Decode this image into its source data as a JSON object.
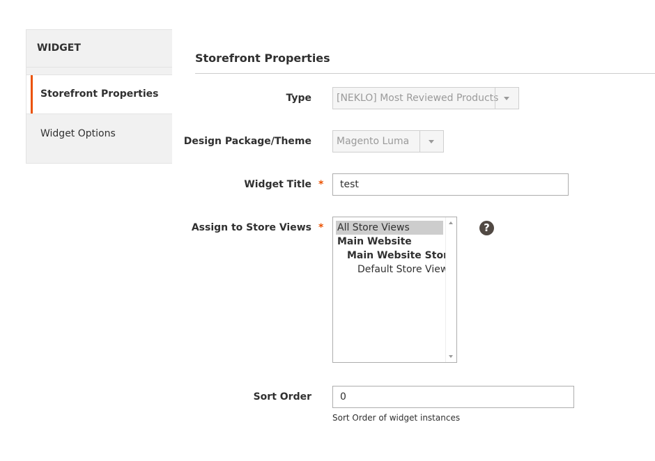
{
  "sidebar": {
    "title": "WIDGET",
    "items": [
      {
        "label": "Storefront Properties",
        "active": true
      },
      {
        "label": "Widget Options",
        "active": false
      }
    ]
  },
  "main": {
    "section_title": "Storefront Properties",
    "fields": {
      "type": {
        "label": "Type",
        "value": "[NEKLO] Most Reviewed Products"
      },
      "theme": {
        "label": "Design Package/Theme",
        "value": "Magento Luma"
      },
      "widget_title": {
        "label": "Widget Title",
        "required_mark": "*",
        "value": "test"
      },
      "store_views": {
        "label": "Assign to Store Views",
        "required_mark": "*",
        "options": [
          "All Store Views",
          "Main Website",
          "Main Website Store",
          "Default Store View"
        ],
        "selected": "All Store Views",
        "help_icon": "?"
      },
      "sort_order": {
        "label": "Sort Order",
        "value": "0",
        "note": "Sort Order of widget instances"
      }
    }
  },
  "icons": {
    "select_arrow": "chevron-down-icon",
    "help": "question-circle-icon"
  },
  "colors": {
    "accent": "#eb5202",
    "help_bg": "#514943"
  }
}
